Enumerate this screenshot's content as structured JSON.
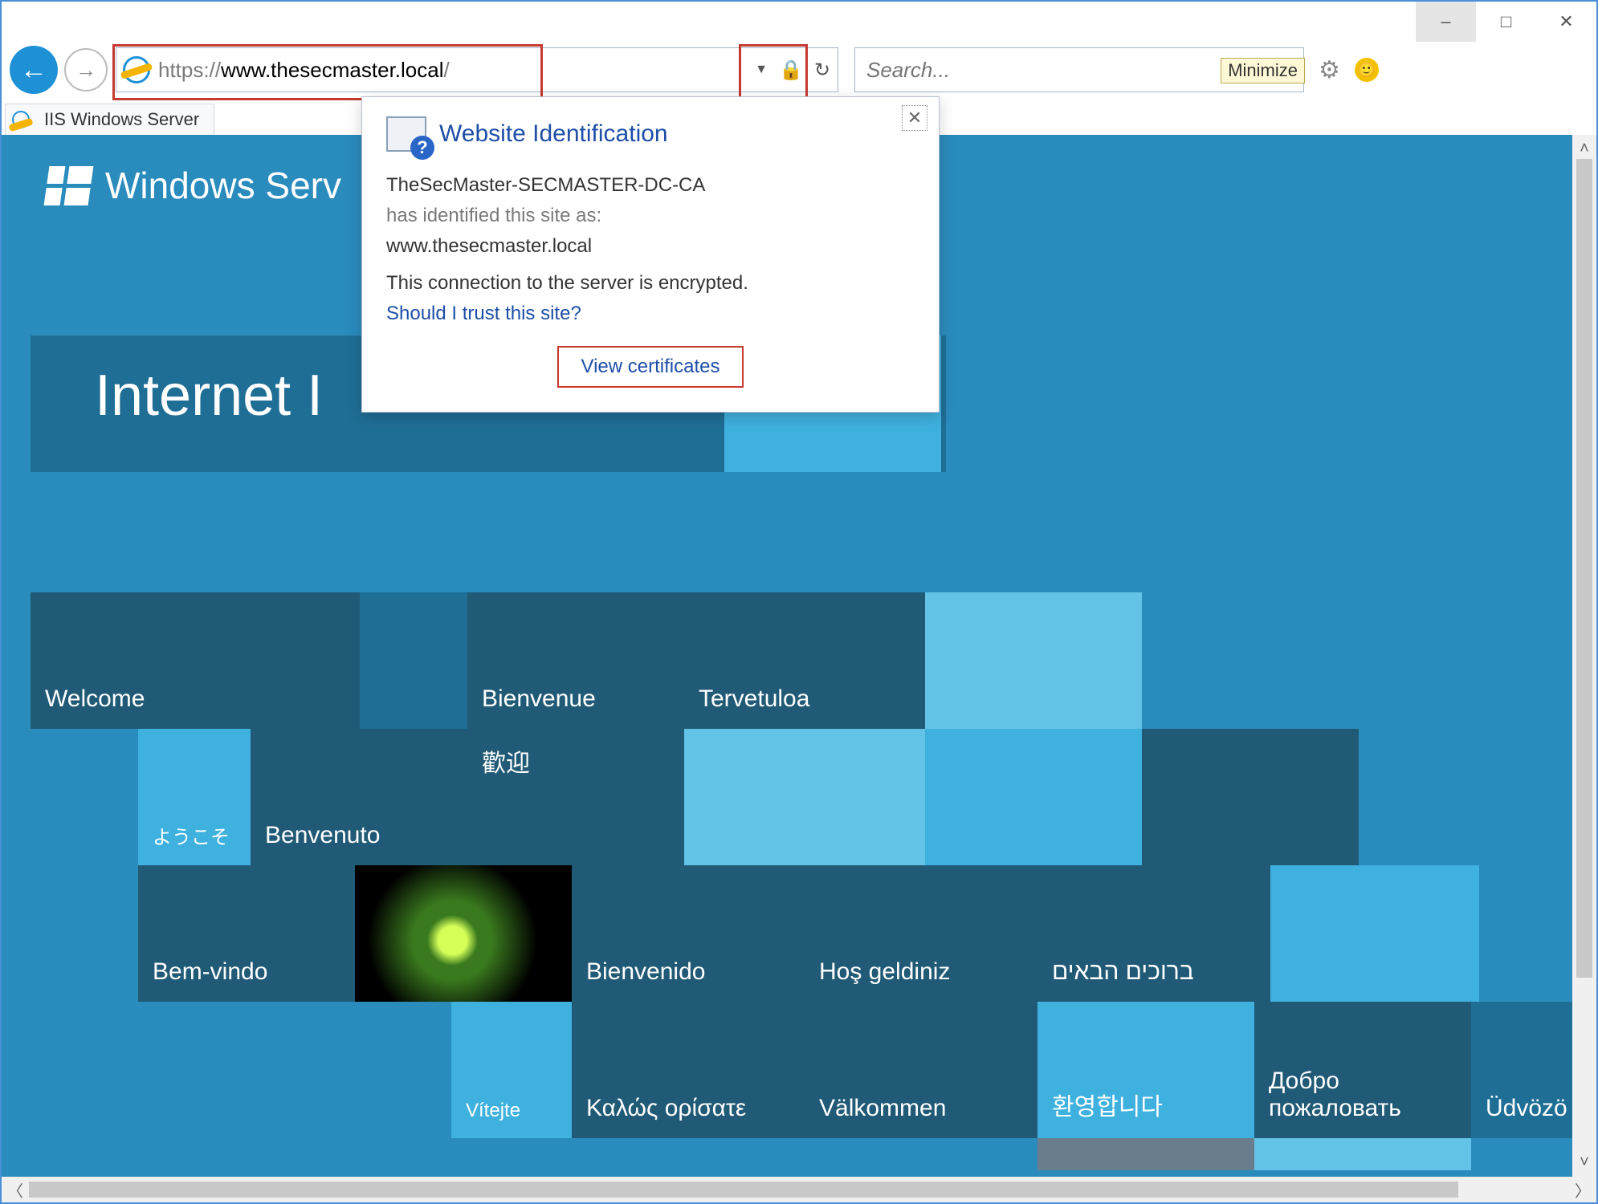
{
  "window_controls": {
    "minimize": "–",
    "maximize": "□",
    "close": "✕",
    "tooltip": "Minimize"
  },
  "addr": {
    "proto": "https://",
    "host": "www.thesecmaster.local",
    "path": "/"
  },
  "search": {
    "placeholder": "Search..."
  },
  "tab": {
    "title": "IIS Windows Server"
  },
  "header": {
    "brand": "Windows Serv",
    "hero": "Internet I"
  },
  "tiles": {
    "welcome": "Welcome",
    "bienvenue": "Bienvenue",
    "tervetuloa": "Tervetuloa",
    "youkoso": "ようこそ",
    "benvenuto": "Benvenuto",
    "huanying": "歡迎",
    "bienvenido": "Bienvenido",
    "hosgeldiniz": "Hoş geldiniz",
    "bruchim": "ברוכים הבאים",
    "bemvindo": "Bem-vindo",
    "vitejte": "Vítejte",
    "kalos": "Καλώς ορίσατε",
    "valkommen": "Välkommen",
    "hwanyeong": "환영합니다",
    "dobro": "Добро пожаловать",
    "udvoz": "Üdvözö"
  },
  "popup": {
    "title": "Website Identification",
    "issuer": "TheSecMaster-SECMASTER-DC-CA",
    "identified": "has identified this site as:",
    "site": "www.thesecmaster.local",
    "encrypted": "This connection to the server is encrypted.",
    "trust": "Should I trust this site?",
    "view": "View certificates"
  }
}
